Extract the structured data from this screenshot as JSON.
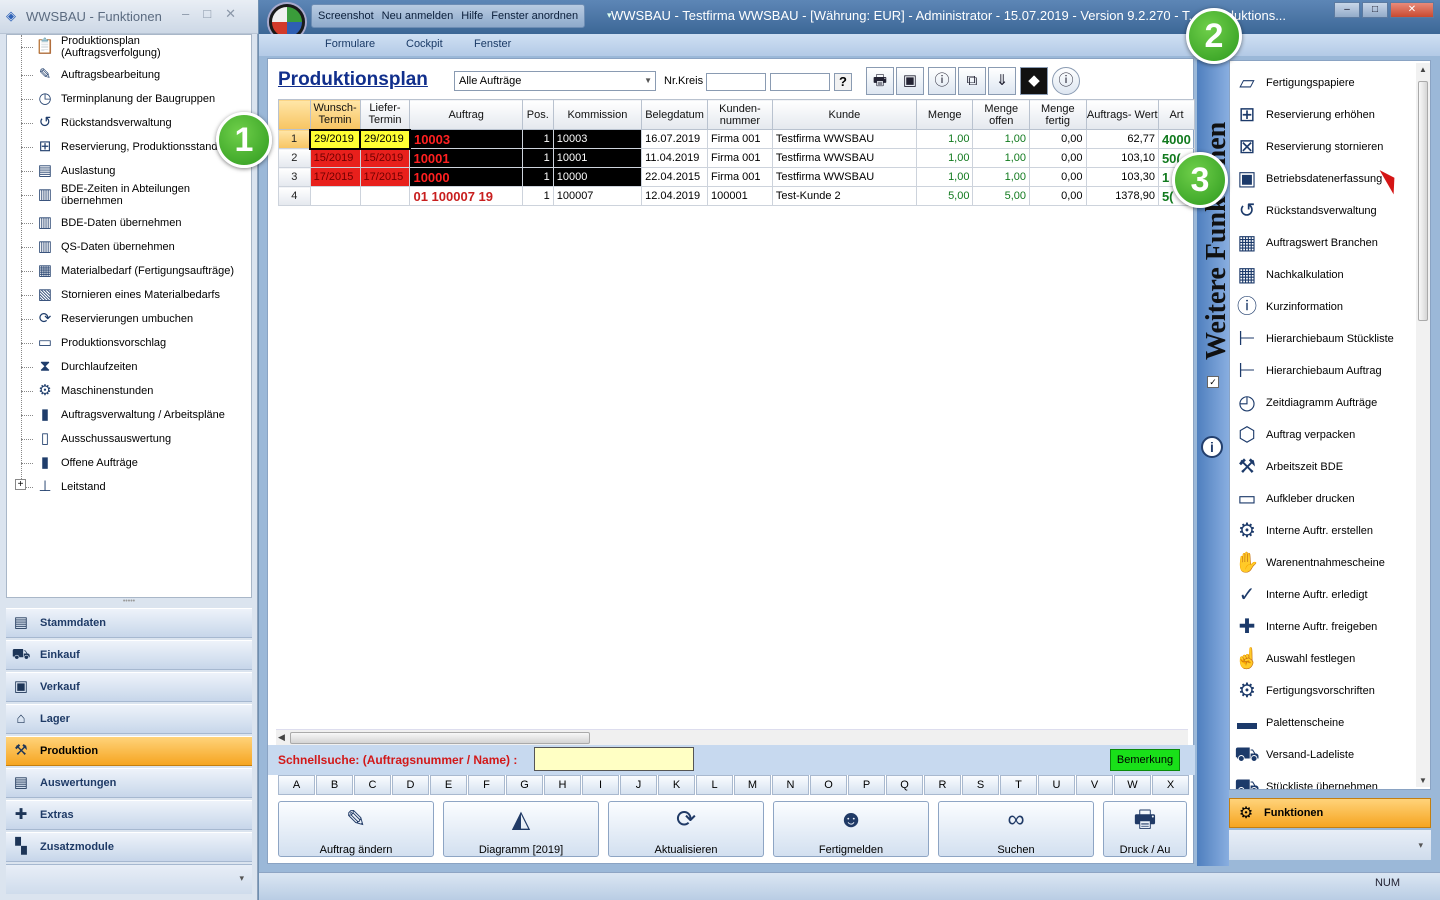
{
  "left_window": {
    "title": "WWSBAU - Funktionen",
    "tree_items": [
      {
        "label": "Produktionsplan (Auftragsverfolgung)",
        "icon": "clipboard-icon"
      },
      {
        "label": "Auftragsbearbeitung",
        "icon": "document-edit-icon"
      },
      {
        "label": "Terminplanung der Baugruppen",
        "icon": "calendar-clock-icon"
      },
      {
        "label": "Rückstandsverwaltung",
        "icon": "clock-back-icon"
      },
      {
        "label": "Reservierung, Produktionsstand",
        "icon": "box-plus-icon"
      },
      {
        "label": "Auslastung",
        "icon": "chart-icon"
      },
      {
        "label": "BDE-Zeiten in Abteilungen übernehmen",
        "icon": "barcode-icon"
      },
      {
        "label": "BDE-Daten übernehmen",
        "icon": "barcode-icon"
      },
      {
        "label": "QS-Daten übernehmen",
        "icon": "barcode-icon"
      },
      {
        "label": "Materialbedarf (Fertigungsaufträge)",
        "icon": "stack-icon"
      },
      {
        "label": "Stornieren eines Materialbedarfs",
        "icon": "stack-cancel-icon"
      },
      {
        "label": "Reservierungen umbuchen",
        "icon": "box-refresh-icon"
      },
      {
        "label": "Produktionsvorschlag",
        "icon": "document-icon"
      },
      {
        "label": "Durchlaufzeiten",
        "icon": "hourglass-icon"
      },
      {
        "label": "Maschinenstunden",
        "icon": "gear-clock-icon"
      },
      {
        "label": "Auftragsverwaltung / Arbeitspläne",
        "icon": "folder-icon"
      },
      {
        "label": "Ausschussauswertung",
        "icon": "trash-icon"
      },
      {
        "label": "Offene Aufträge",
        "icon": "folder-icon"
      },
      {
        "label": "Leitstand",
        "icon": "control-icon"
      }
    ],
    "nav": [
      {
        "label": "Stammdaten",
        "icon": "database-icon",
        "active": false
      },
      {
        "label": "Einkauf",
        "icon": "cart-icon",
        "active": false
      },
      {
        "label": "Verkauf",
        "icon": "register-icon",
        "active": false
      },
      {
        "label": "Lager",
        "icon": "warehouse-icon",
        "active": false
      },
      {
        "label": "Produktion",
        "icon": "hammer-icon",
        "active": true
      },
      {
        "label": "Auswertungen",
        "icon": "chart-icon",
        "active": false
      },
      {
        "label": "Extras",
        "icon": "plus-icon",
        "active": false
      },
      {
        "label": "Zusatzmodule",
        "icon": "modules-icon",
        "active": false
      }
    ]
  },
  "main_window": {
    "menu": [
      "Screenshot",
      "Neu anmelden",
      "Hilfe",
      "Fenster anordnen"
    ],
    "title": "WWSBAU - Testfirma WWSBAU - [Währung: EUR] - Administrator - 15.07.2019 - Version 9.2.270 - T... [Produktions...",
    "ribbon_tabs": [
      "Formulare",
      "Cockpit",
      "Fenster"
    ],
    "window_buttons": {
      "minimize": "–",
      "restore": "□",
      "close": "✕"
    }
  },
  "produktionsplan": {
    "title": "Produktionsplan",
    "filter_value": "Alle Aufträge",
    "nrkreis_label": "Nr.Kreis",
    "help_label": "?",
    "toolbar_icons": [
      "printer-icon",
      "screen-icon",
      "info-doc-icon",
      "copy-icon",
      "sort-down-icon",
      "expand-icon",
      "info-icon"
    ],
    "columns": [
      "",
      "Wunsch-Termin",
      "Liefer-Termin",
      "Auftrag",
      "Pos.",
      "Kommission",
      "Belegdatum",
      "Kunden-nummer",
      "Kunde",
      "Menge",
      "Menge offen",
      "Menge fertig",
      "Auftrags- Wert",
      "Art"
    ],
    "rows": [
      {
        "n": "1",
        "wunsch": "29/2019",
        "liefer": "29/2019",
        "auftrag": "10003",
        "pos": "1",
        "kommission": "10003",
        "beleg": "16.07.2019",
        "kdnr": "Firma 001",
        "kunde": "Testfirma WWSBAU",
        "menge": "1,00",
        "offen": "1,00",
        "fertig": "0,00",
        "wert": "62,77",
        "art": "4000"
      },
      {
        "n": "2",
        "wunsch": "15/2019",
        "liefer": "15/2019",
        "auftrag": "10001",
        "pos": "1",
        "kommission": "10001",
        "beleg": "11.04.2019",
        "kdnr": "Firma 001",
        "kunde": "Testfirma WWSBAU",
        "menge": "1,00",
        "offen": "1,00",
        "fertig": "0,00",
        "wert": "103,10",
        "art": "50("
      },
      {
        "n": "3",
        "wunsch": "17/2015",
        "liefer": "17/2015",
        "auftrag": "10000",
        "pos": "1",
        "kommission": "10000",
        "beleg": "22.04.2015",
        "kdnr": "Firma 001",
        "kunde": "Testfirma WWSBAU",
        "menge": "1,00",
        "offen": "1,00",
        "fertig": "0,00",
        "wert": "103,30",
        "art": "1"
      },
      {
        "n": "4",
        "wunsch": "",
        "liefer": "",
        "auftrag": "01 100007 19",
        "pos": "1",
        "kommission": "100007",
        "beleg": "12.04.2019",
        "kdnr": "100001",
        "kunde": "Test-Kunde 2",
        "menge": "5,00",
        "offen": "5,00",
        "fertig": "0,00",
        "wert": "1378,90",
        "art": "5("
      }
    ],
    "schnellsuche_label": "Schnellsuche: (Auftragsnummer / Name) :",
    "bemerkung_label": "Bemerkung",
    "letters": [
      "A",
      "B",
      "C",
      "D",
      "E",
      "F",
      "G",
      "H",
      "I",
      "J",
      "K",
      "L",
      "M",
      "N",
      "O",
      "P",
      "Q",
      "R",
      "S",
      "T",
      "U",
      "V",
      "W",
      "X"
    ],
    "actions": [
      {
        "label": "Auftrag ändern",
        "icon": "edit-doc-icon"
      },
      {
        "label": "Diagramm [2019]",
        "icon": "area-chart-icon"
      },
      {
        "label": "Aktualisieren",
        "icon": "refresh-icon"
      },
      {
        "label": "Fertigmelden",
        "icon": "user-check-icon"
      },
      {
        "label": "Suchen",
        "icon": "binoculars-icon"
      },
      {
        "label": "Druck / Au",
        "icon": "printer-icon"
      }
    ],
    "status_num": "NUM"
  },
  "side_panel": {
    "vertical_title": "Weitere Funktionen",
    "items": [
      {
        "label": "Fertigungspapiere",
        "icon": "folder-open-icon"
      },
      {
        "label": "Reservierung erhöhen",
        "icon": "box-plus-icon"
      },
      {
        "label": "Reservierung stornieren",
        "icon": "box-cancel-icon"
      },
      {
        "label": "Betriebsdatenerfassung",
        "icon": "terminal-icon"
      },
      {
        "label": "Rückstandsverwaltung",
        "icon": "clock-back-icon"
      },
      {
        "label": "Auftragswert Branchen",
        "icon": "calculator-doc-icon"
      },
      {
        "label": "Nachkalkulation",
        "icon": "calculator-icon"
      },
      {
        "label": "Kurzinformation",
        "icon": "info-doc-icon"
      },
      {
        "label": "Hierarchiebaum Stückliste",
        "icon": "tree-icon"
      },
      {
        "label": "Hierarchiebaum Auftrag",
        "icon": "tree-icon"
      },
      {
        "label": "Zeitdiagramm Aufträge",
        "icon": "clock-chart-icon"
      },
      {
        "label": "Auftrag verpacken",
        "icon": "package-icon"
      },
      {
        "label": "Arbeitszeit BDE",
        "icon": "tools-clock-icon"
      },
      {
        "label": "Aufkleber drucken",
        "icon": "label-print-icon"
      },
      {
        "label": "Interne Auftr. erstellen",
        "icon": "doc-gear-icon"
      },
      {
        "label": "Warenentnahmescheine",
        "icon": "hand-box-icon"
      },
      {
        "label": "Interne Auftr. erledigt",
        "icon": "doc-check-icon"
      },
      {
        "label": "Interne Auftr. freigeben",
        "icon": "doc-plus-icon"
      },
      {
        "label": "Auswahl festlegen",
        "icon": "pointer-check-icon"
      },
      {
        "label": "Fertigungsvorschriften",
        "icon": "gear-warning-icon"
      },
      {
        "label": "Palettenscheine",
        "icon": "pallet-icon"
      },
      {
        "label": "Versand-Ladeliste",
        "icon": "truck-icon"
      },
      {
        "label": "Stückliste übernehmen",
        "icon": "truck-icon"
      }
    ],
    "funktionen_label": "Funktionen"
  },
  "badges": [
    "1",
    "2",
    "3"
  ]
}
